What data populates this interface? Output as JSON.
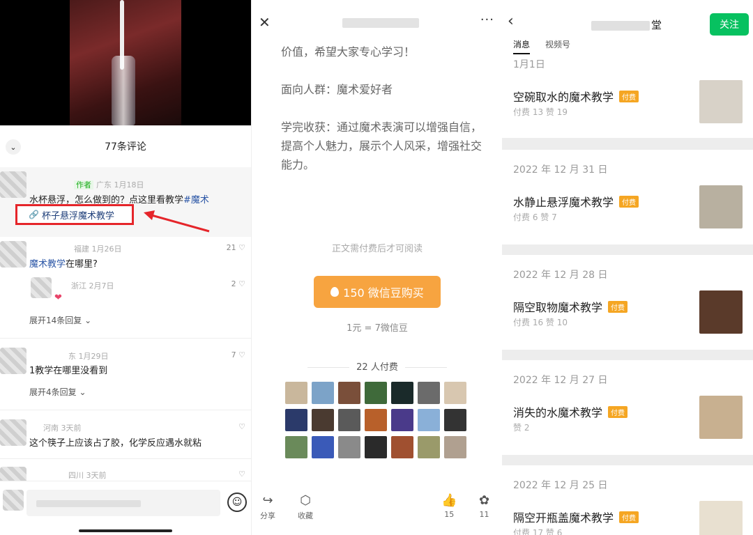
{
  "comments_panel": {
    "sheet_title": "77条评论",
    "comments": [
      {
        "author_badge": "作者",
        "meta": "广东 1月18日",
        "text_prefix": "水杯悬浮，怎么做到的？点这里看教学",
        "text_tag": "#魔术",
        "link_text": "杯子悬浮魔术教学"
      },
      {
        "meta": "福建 1月26日",
        "likes": "21",
        "text_tag": "魔术教学",
        "text_suffix": "在哪里?"
      },
      {
        "meta": "浙江 2月7日",
        "likes": "2"
      },
      {
        "meta": "东 1月29日",
        "likes": "7",
        "text": "1教学在哪里没看到"
      },
      {
        "meta": "河南 3天前",
        "text": "这个筷子上应该占了胶，化学反应遇水就粘"
      },
      {
        "meta": "四川 3天前"
      }
    ],
    "expand_1": "展开14条回复",
    "expand_2": "展开4条回复"
  },
  "article_panel": {
    "body_lines": [
      "价值，希望大家专心学习！",
      "面向人群：魔术爱好者",
      "学完收获：通过魔术表演可以增强自信，提高个人魅力，展示个人风采，增强社交能力。"
    ],
    "paywall_note": "正文需付费后才可阅读",
    "buy_label": "150 微信豆购买",
    "rate": "1元 = 7微信豆",
    "payers": "22 人付费",
    "avatar_colors": [
      "#c9b79c",
      "#7ca3c8",
      "#7a4f3a",
      "#3f6a3a",
      "#1a2a2a",
      "#6b6b6b",
      "#d8c7b0",
      "#2b3a6a",
      "#4a3a30",
      "#5a5a5a",
      "#b8602a",
      "#4a3a8a",
      "#8ab0d8",
      "#333333",
      "#6a8a5a",
      "#3a5ab8",
      "#8a8a8a",
      "#2a2a2a",
      "#a05030",
      "#9a9a6a",
      "#b0a090"
    ],
    "bottom": {
      "share": "分享",
      "collect": "收藏",
      "likes": "15",
      "wow": "11"
    }
  },
  "channel_panel": {
    "follow": "关注",
    "title_suffix": "堂",
    "tabs": [
      "消息",
      "视频号"
    ],
    "paid_label": "付费",
    "posts": [
      {
        "date": "1月1日",
        "title": "空碗取水的魔术教学",
        "stats": "付费 13  赞 19",
        "thumb": "#d8d2c8"
      },
      {
        "date": "2022 年 12 月 31 日",
        "title": "水静止悬浮魔术教学",
        "stats": "付费 6  赞 7",
        "thumb": "#b8b0a0"
      },
      {
        "date": "2022 年 12 月 28 日",
        "title": "隔空取物魔术教学",
        "stats": "付费 16  赞 10",
        "thumb": "#5a3a2a"
      },
      {
        "date": "2022 年 12 月 27 日",
        "title": "消失的水魔术教学",
        "stats": "赞 2",
        "thumb": "#c8b090"
      },
      {
        "date": "2022 年 12 月 25 日",
        "title": "隔空开瓶盖魔术教学",
        "stats": "付费 17  赞 6",
        "thumb": "#e8e0d0"
      }
    ]
  }
}
